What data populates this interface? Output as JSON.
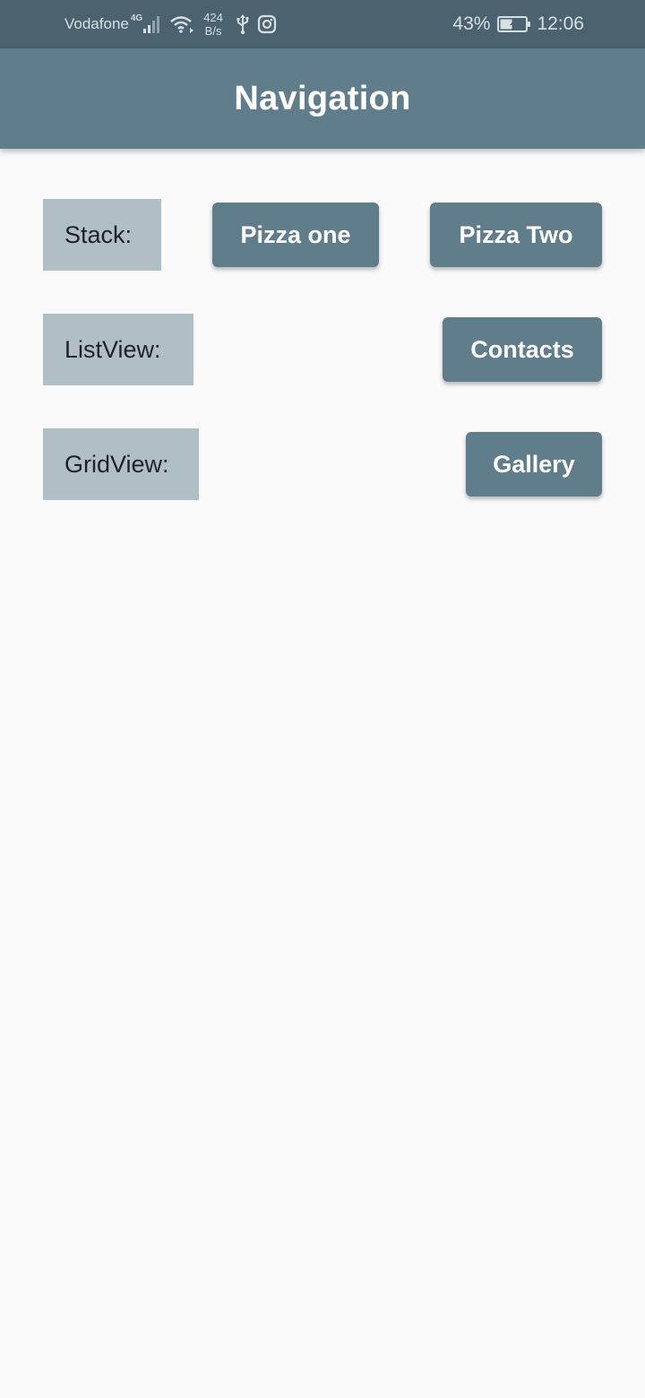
{
  "status_bar": {
    "carrier": "Vodafone",
    "network_type": "4G",
    "speed_value": "424",
    "speed_unit": "B/s",
    "battery_percent": "43%",
    "time": "12:06",
    "icons": [
      "signal-icon",
      "wifi-icon",
      "usb-icon",
      "instagram-icon",
      "battery-charging-icon"
    ],
    "background_color": "#4b636e"
  },
  "app_bar": {
    "title": "Navigation",
    "color": "#607d8b"
  },
  "rows": [
    {
      "label": "Stack:",
      "buttons": [
        "Pizza one",
        "Pizza Two"
      ]
    },
    {
      "label": "ListView:",
      "buttons": [
        "Contacts"
      ]
    },
    {
      "label": "GridView:",
      "buttons": [
        "Gallery"
      ]
    }
  ],
  "colors": {
    "button": "#607d8b",
    "label_background": "#b0bec5",
    "page_background": "#fafafa"
  }
}
